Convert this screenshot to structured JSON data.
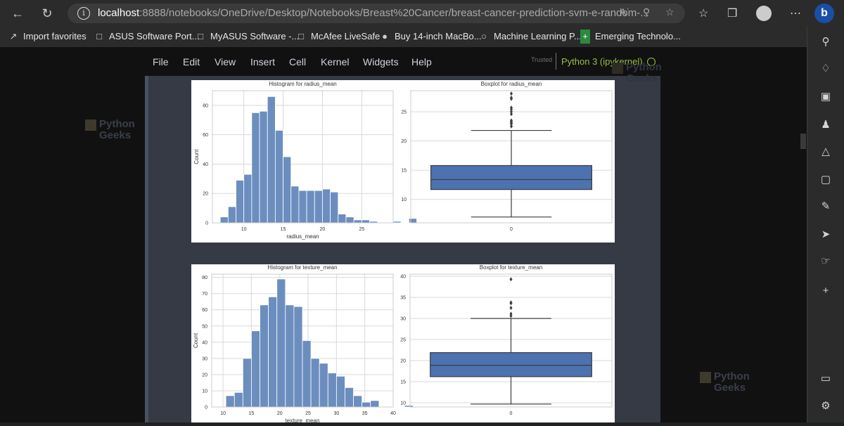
{
  "browser": {
    "url_host": "localhost",
    "url_rest": ":8888/notebooks/OneDrive/Desktop/Notebooks/Breast%20Cancer/breast-cancer-prediction-svm-e-random-..."
  },
  "favorites": [
    {
      "label": "Import favorites",
      "icon": "import-icon"
    },
    {
      "label": "ASUS Software Port...",
      "icon": "page-icon"
    },
    {
      "label": "MyASUS Software -...",
      "icon": "page-icon"
    },
    {
      "label": "McAfee LiveSafe",
      "icon": "page-icon"
    },
    {
      "label": "Buy 14-inch MacBo...",
      "icon": "apple-icon"
    },
    {
      "label": "Machine Learning P...",
      "icon": "python-geeks-icon"
    },
    {
      "label": "Emerging Technolo...",
      "icon": "green-plus-icon"
    }
  ],
  "jupyter": {
    "menu": [
      "File",
      "Edit",
      "View",
      "Insert",
      "Cell",
      "Kernel",
      "Widgets",
      "Help"
    ],
    "trusted": "Trusted",
    "kernel": "Python 3 (ipykernel)"
  },
  "watermark": {
    "line1": "Python",
    "line2": "Geeks"
  },
  "chart_data": [
    {
      "type": "bar",
      "title": "Histogram for radius_mean",
      "xlabel": "radius_mean",
      "ylabel": "Count",
      "bin_start": 7,
      "bin_width": 1,
      "values": [
        4,
        11,
        29,
        33,
        75,
        76,
        86,
        63,
        45,
        25,
        22,
        22,
        22,
        23,
        21,
        6,
        4,
        2,
        2,
        1,
        0,
        0,
        1,
        0,
        3
      ],
      "xticks": [
        "10",
        "15",
        "20",
        "25"
      ],
      "yticks": [
        "0",
        "20",
        "40",
        "60",
        "80"
      ],
      "xlim": [
        6,
        29
      ],
      "ylim": [
        0,
        90
      ]
    },
    {
      "type": "box",
      "title": "Boxplot for radius_mean",
      "category": "0",
      "whisker_low": 7.0,
      "q1": 11.7,
      "median": 13.4,
      "q3": 15.8,
      "whisker_high": 21.8,
      "outliers": [
        22.5,
        22.9,
        23.1,
        23.3,
        23.5,
        24.6,
        25.0,
        25.4,
        25.7,
        27.2,
        27.4,
        28.1
      ],
      "yticks": [
        "10",
        "15",
        "20",
        "25"
      ],
      "ylim": [
        6,
        28.6
      ]
    },
    {
      "type": "bar",
      "title": "Histogram for texture_mean",
      "xlabel": "texture_mean",
      "ylabel": "Count",
      "bin_start": 10.5,
      "bin_width": 1.5,
      "values": [
        7,
        9,
        30,
        47,
        63,
        68,
        79,
        63,
        62,
        41,
        30,
        27,
        21,
        19,
        12,
        7,
        3,
        4,
        0,
        0,
        0,
        1
      ],
      "xticks": [
        "10",
        "15",
        "20",
        "25",
        "30",
        "35",
        "40"
      ],
      "yticks": [
        "0",
        "10",
        "20",
        "30",
        "40",
        "50",
        "60",
        "70",
        "80"
      ],
      "xlim": [
        8,
        40
      ],
      "ylim": [
        0,
        82
      ]
    },
    {
      "type": "box",
      "title": "Boxplot for texture_mean",
      "category": "0",
      "whisker_low": 9.7,
      "q1": 16.2,
      "median": 18.9,
      "q3": 21.9,
      "whisker_high": 30,
      "outliers": [
        30.6,
        31.1,
        32.5,
        33.6,
        33.8,
        39.3
      ],
      "yticks": [
        "10",
        "15",
        "20",
        "25",
        "30",
        "35",
        "40"
      ],
      "ylim": [
        9,
        40.5
      ]
    }
  ]
}
